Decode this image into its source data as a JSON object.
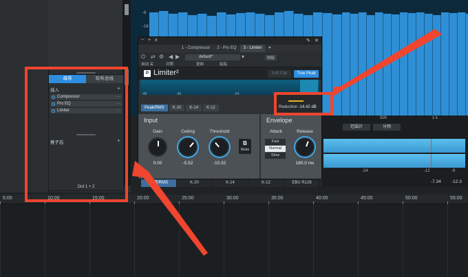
{
  "spectrum": {
    "db_labels": [
      "-6",
      "-18"
    ],
    "axis_labels": [
      "500",
      "1 k"
    ]
  },
  "mixer": {
    "tabs": [
      "母带",
      "聆听总线"
    ],
    "inserts_label": "插入",
    "inserts": [
      "Compressor",
      "Pro EQ",
      "Limiter"
    ],
    "sends_label": "推子后",
    "output": "Out 1 + 2"
  },
  "limiter": {
    "tabs": [
      "1 - Compressor",
      "2 - Pro EQ",
      "3 - Limiter"
    ],
    "preset": "default*",
    "toolbar_labels": [
      "自动 关",
      "对照",
      "复制",
      "粘贴",
      "侧链"
    ],
    "title": "Limiter²",
    "soft_clip": "Soft Clip",
    "true_peak": "True Peak",
    "meter_scale": [
      "-48",
      "-36",
      "-24",
      "-12"
    ],
    "reduction_label": "Reduction",
    "reduction_value": "-14.42 dB",
    "mode_tabs": [
      "Peak/RMS",
      "K-20",
      "K-14",
      "K-12"
    ],
    "input": {
      "title": "Input",
      "gain_label": "Gain",
      "gain_value": "0.00",
      "ceiling_label": "Ceiling",
      "ceiling_value": "-5.52",
      "threshold_label": "Threshold",
      "threshold_value": "-10.32",
      "mode_letter": "B",
      "mode_label": "Mode"
    },
    "envelope": {
      "title": "Envelope",
      "attack_label": "Attack",
      "attack_options": [
        "Fast",
        "Normal",
        "Slow"
      ],
      "attack_selected": "Normal",
      "release_label": "Release",
      "release_value": "180.0 ms"
    }
  },
  "bottom_tabs": [
    "峰值/RMS",
    "K-20",
    "K-14",
    "K-12",
    "EBU R128"
  ],
  "right_panel": {
    "buttons": [
      "范围计",
      "分频"
    ],
    "scale": [
      "-24",
      "-12",
      "-9"
    ],
    "values": [
      "-7.34",
      "-12.3"
    ]
  },
  "timeline": {
    "labels": [
      "5:00",
      "10:00",
      "15:00",
      "20:00",
      "25:00",
      "30:00",
      "35:00",
      "40:00",
      "45:00",
      "50:00",
      "55:00"
    ]
  },
  "colors": {
    "accent": "#2d8ee0",
    "annotation": "#f0452e",
    "reduction_bar": "#e6b320"
  }
}
